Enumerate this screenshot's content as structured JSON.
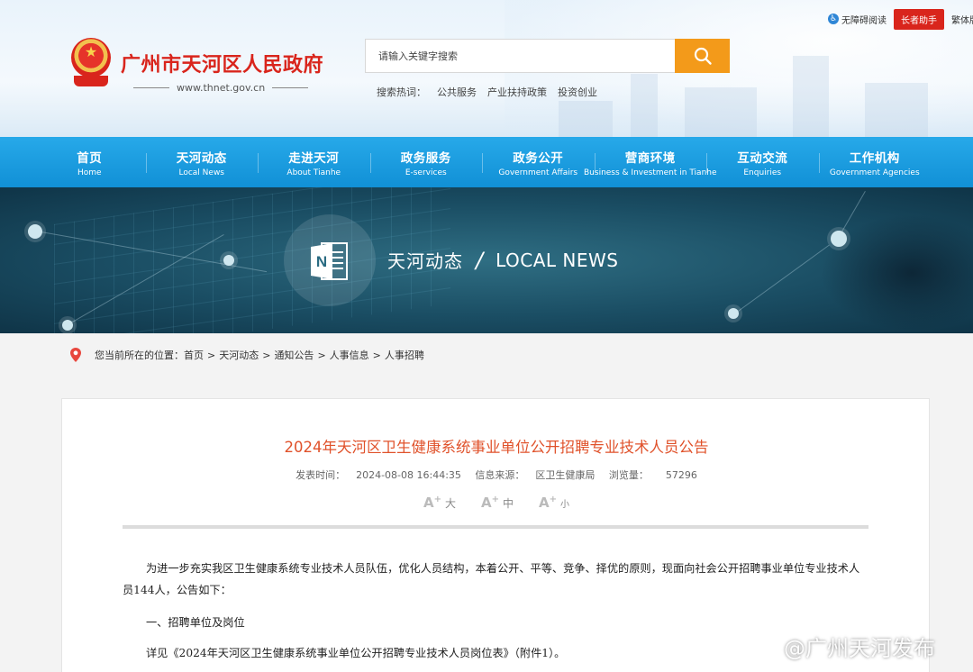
{
  "topbar": {
    "accessibility": "无障碍阅读",
    "elder_mode": "长者助手",
    "traditional": "繁体版"
  },
  "logo": {
    "name": "广州市天河区人民政府",
    "domain": "www.thnet.gov.cn"
  },
  "search": {
    "placeholder": "请输入关键字搜索",
    "hot_label": "搜索热词：",
    "hot_words": [
      "公共服务",
      "产业扶持政策",
      "投资创业"
    ]
  },
  "nav": [
    {
      "cn": "首页",
      "en": "Home"
    },
    {
      "cn": "天河动态",
      "en": "Local News"
    },
    {
      "cn": "走进天河",
      "en": "About Tianhe"
    },
    {
      "cn": "政务服务",
      "en": "E-services"
    },
    {
      "cn": "政务公开",
      "en": "Government Affairs"
    },
    {
      "cn": "营商环境",
      "en": "Business & Investment in Tianhe"
    },
    {
      "cn": "互动交流",
      "en": "Enquiries"
    },
    {
      "cn": "工作机构",
      "en": "Government Agencies"
    }
  ],
  "banner": {
    "cn": "天河动态",
    "sep": "/",
    "en": "LOCAL NEWS"
  },
  "breadcrumb": {
    "label": "您当前所在的位置：",
    "items": [
      "首页",
      "天河动态",
      "通知公告",
      "人事信息",
      "人事招聘"
    ],
    "sep": ">"
  },
  "article": {
    "title": "2024年天河区卫生健康系统事业单位公开招聘专业技术人员公告",
    "publish_label": "发表时间：",
    "publish_time": "2024-08-08 16:44:35",
    "source_label": "信息来源：",
    "source": "区卫生健康局",
    "views_label": "浏览量：",
    "views": "57296",
    "font_sizes": [
      "大",
      "中",
      "小"
    ],
    "paragraphs": [
      "为进一步充实我区卫生健康系统专业技术人员队伍，优化人员结构，本着公开、平等、竞争、择优的原则，现面向社会公开招聘事业单位专业技术人员144人，公告如下：",
      "一、招聘单位及岗位",
      "详见《2024年天河区卫生健康系统事业单位公开招聘专业技术人员岗位表》（附件1）。"
    ]
  },
  "watermark": "@广州天河发布",
  "colors": {
    "nav": "#1a9fe3",
    "brand_red": "#d9251c",
    "search_orange": "#f39a1a",
    "title_orange": "#e0522b"
  }
}
